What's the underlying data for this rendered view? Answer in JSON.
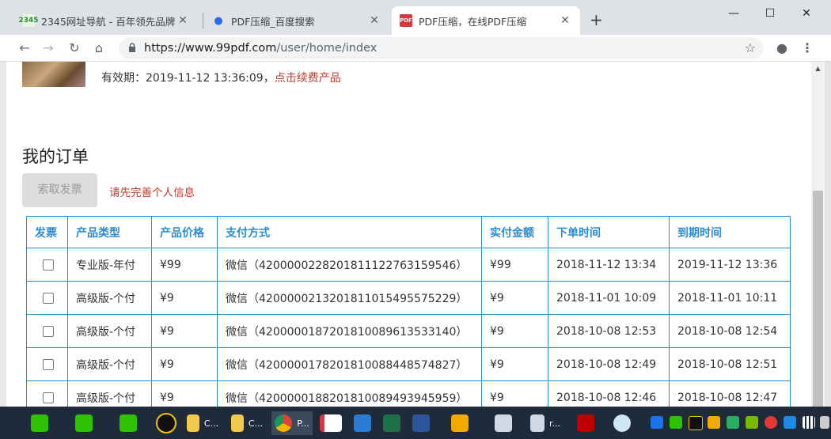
{
  "browser": {
    "tabs": [
      {
        "title": "2345网址导航 - 百年领先品牌（",
        "favicon": "2345",
        "active": false
      },
      {
        "title": "PDF压缩_百度搜索",
        "favicon": "paw",
        "active": false
      },
      {
        "title": "PDF压缩，在线PDF压缩",
        "favicon": "PDF",
        "active": true
      }
    ],
    "new_tab_label": "+",
    "window_controls": {
      "minimize": "—",
      "maximize": "☐",
      "close": "✕"
    },
    "url_host": "https://www.99pdf.com",
    "url_path": "/user/home/index"
  },
  "page": {
    "validity_label": "有效期：2019-11-12 13:36:09，",
    "renew_link": "点击续费产品",
    "orders_title": "我的订单",
    "invoice_button": "索取发票",
    "complete_info_notice": "请先完善个人信息",
    "table": {
      "headers": [
        "发票",
        "产品类型",
        "产品价格",
        "支付方式",
        "实付金额",
        "下单时间",
        "到期时间"
      ],
      "rows": [
        [
          "专业版-年付",
          "¥99",
          "微信（4200000228201811122763159546）",
          "¥99",
          "2018-11-12 13:34",
          "2019-11-12 13:36"
        ],
        [
          "高级版-个付",
          "¥9",
          "微信（4200000213201811015495575229）",
          "¥9",
          "2018-11-01 10:09",
          "2018-11-01 10:11"
        ],
        [
          "高级版-个付",
          "¥9",
          "微信（4200000187201810089613533140）",
          "¥9",
          "2018-10-08 12:53",
          "2018-10-08 12:54"
        ],
        [
          "高级版-个付",
          "¥9",
          "微信（4200000178201810088448574827）",
          "¥9",
          "2018-10-08 12:49",
          "2018-10-08 12:51"
        ],
        [
          "高级版-个付",
          "¥9",
          "微信（4200000188201810089493945959）",
          "¥9",
          "2018-10-08 12:46",
          "2018-10-08 12:47"
        ]
      ]
    }
  },
  "taskbar": {
    "items": [
      {
        "name": "wechat-1",
        "label": ""
      },
      {
        "name": "wechat-2",
        "label": ""
      },
      {
        "name": "wechat-3",
        "label": ""
      },
      {
        "name": "qq",
        "label": ""
      },
      {
        "name": "folder-1",
        "label": "C..."
      },
      {
        "name": "folder-2",
        "label": "C..."
      },
      {
        "name": "chrome",
        "label": "P..."
      },
      {
        "name": "pdf-reader",
        "label": ""
      },
      {
        "name": "app-blue",
        "label": ""
      },
      {
        "name": "excel",
        "label": ""
      },
      {
        "name": "word",
        "label": ""
      },
      {
        "name": "outlook",
        "label": ""
      },
      {
        "name": "remote-1",
        "label": ""
      },
      {
        "name": "remote-2",
        "label": "r..."
      },
      {
        "name": "filezilla",
        "label": ""
      },
      {
        "name": "user-app",
        "label": ""
      }
    ]
  },
  "colors": {
    "accent": "#2d8ccf",
    "link_red": "#c0392b"
  }
}
